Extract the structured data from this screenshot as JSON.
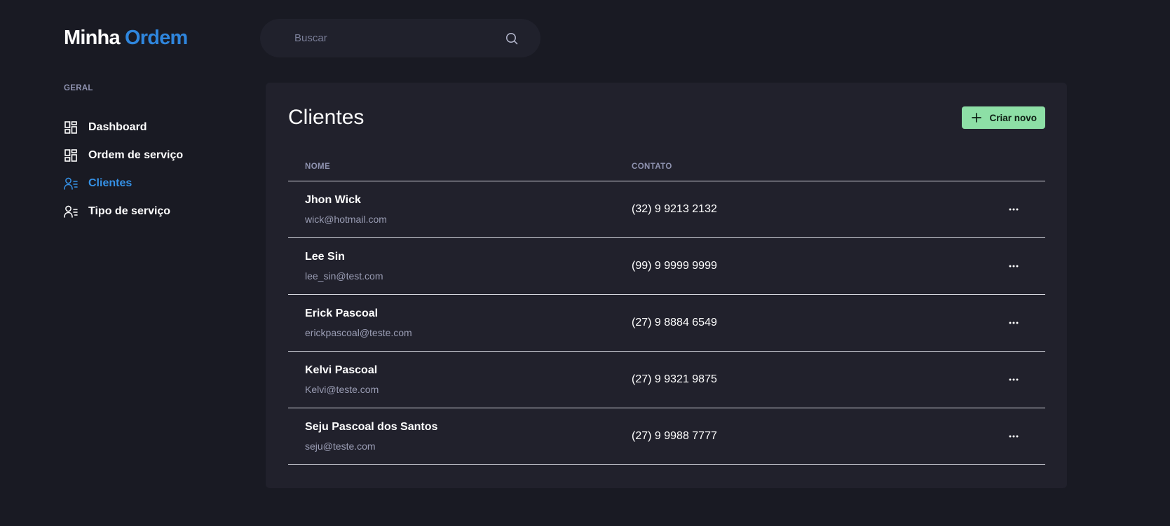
{
  "logo": {
    "part1": "Minha",
    "part2": "Ordem"
  },
  "sidebar": {
    "section_label": "GERAL",
    "items": [
      {
        "label": "Dashboard",
        "icon": "dashboard-icon"
      },
      {
        "label": "Ordem de serviço",
        "icon": "dashboard-icon"
      },
      {
        "label": "Clientes",
        "icon": "users-list-icon",
        "active": true
      },
      {
        "label": "Tipo de serviço",
        "icon": "users-list-icon"
      }
    ]
  },
  "search": {
    "placeholder": "Buscar",
    "value": "",
    "icon": "search-icon"
  },
  "page": {
    "title": "Clientes",
    "new_button_label": "Criar novo",
    "new_button_icon": "plus-icon"
  },
  "table": {
    "columns": {
      "name": "NOME",
      "contact": "CONTATO"
    },
    "rows": [
      {
        "name": "Jhon Wick",
        "email": "wick@hotmail.com",
        "phone": "(32) 9 9213 2132"
      },
      {
        "name": "Lee Sin",
        "email": "lee_sin@test.com",
        "phone": "(99) 9 9999 9999"
      },
      {
        "name": "Erick Pascoal",
        "email": "erickpascoal@teste.com",
        "phone": "(27) 9 8884 6549"
      },
      {
        "name": "Kelvi Pascoal",
        "email": "Kelvi@teste.com",
        "phone": "(27) 9 9321 9875"
      },
      {
        "name": "Seju Pascoal dos Santos",
        "email": "seju@teste.com",
        "phone": "(27) 9 9988 7777"
      }
    ]
  },
  "colors": {
    "background": "#191a23",
    "card": "#21212c",
    "accent_blue": "#3591e6",
    "accent_green": "#8ddfa6",
    "muted": "#8f93b0"
  }
}
